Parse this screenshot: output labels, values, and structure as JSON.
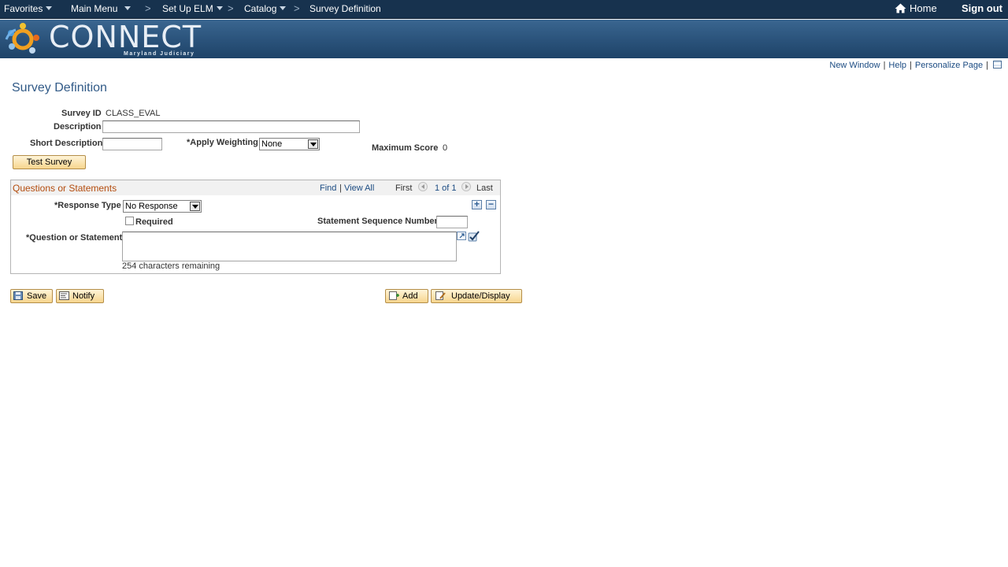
{
  "nav": {
    "favorites": "Favorites",
    "main_menu": "Main Menu",
    "setup_elm": "Set Up ELM",
    "catalog": "Catalog",
    "current": "Survey Definition",
    "separator": ">",
    "home": "Home",
    "sign_out": "Sign out"
  },
  "banner": {
    "logo_text": "CONNECT",
    "logo_sub": "Maryland Judiciary"
  },
  "pagebar": {
    "new_window": "New Window",
    "help": "Help",
    "personalize": "Personalize Page",
    "separator": "|"
  },
  "page": {
    "title": "Survey Definition"
  },
  "form": {
    "survey_id_label": "Survey ID",
    "survey_id_value": "CLASS_EVAL",
    "description_label": "Description",
    "description_value": "",
    "short_description_label": "Short Description",
    "short_description_value": "",
    "apply_weighting_label": "*Apply Weighting",
    "apply_weighting_value": "None",
    "maximum_score_label": "Maximum Score",
    "maximum_score_value": "0",
    "test_survey_button": "Test Survey"
  },
  "questions": {
    "title": "Questions or Statements",
    "find": "Find",
    "view_all": "View All",
    "separator": "|",
    "first": "First",
    "counter": "1 of 1",
    "last": "Last",
    "response_type_label": "*Response Type",
    "response_type_value": "No Response",
    "required_label": "Required",
    "required_checked": false,
    "sequence_label": "Statement Sequence Number",
    "sequence_value": "",
    "question_label": "*Question or Statement",
    "question_value": "",
    "chars_remaining": "254 characters remaining",
    "add_row_symbol": "+",
    "delete_row_symbol": "−"
  },
  "toolbar": {
    "save": "Save",
    "notify": "Notify",
    "add": "Add",
    "update_display": "Update/Display"
  },
  "colors": {
    "nav_bg": "#17324e",
    "banner_bg": "#2a527a",
    "title_color": "#315a87",
    "group_title": "#b34b0c",
    "link": "#1b4b82"
  }
}
